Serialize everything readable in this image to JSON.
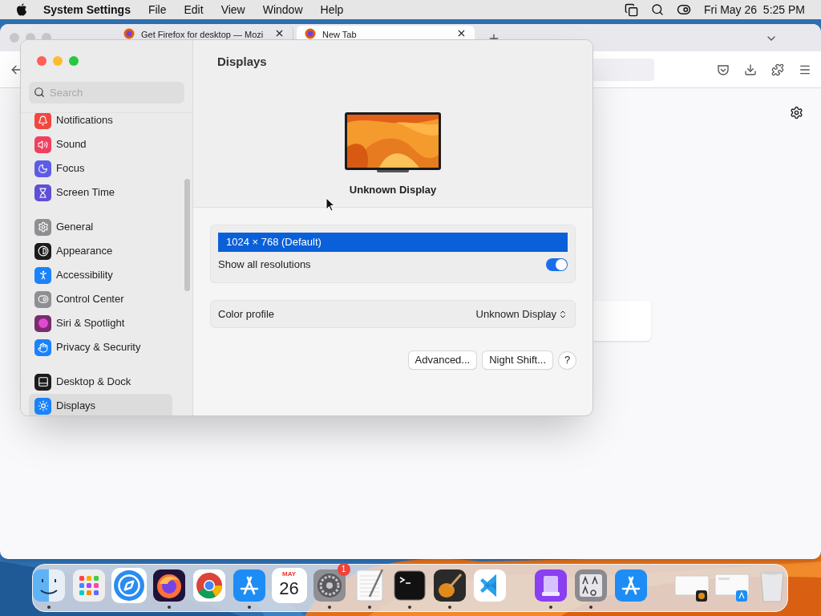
{
  "menu_bar": {
    "app": "System Settings",
    "menus": [
      "File",
      "Edit",
      "View",
      "Window",
      "Help"
    ],
    "clock": "Fri May 26  5:25 PM"
  },
  "browser": {
    "tabs": [
      {
        "title": "Get Firefox for desktop — Mozi",
        "selected": false
      },
      {
        "title": "New Tab",
        "selected": true
      }
    ]
  },
  "settings": {
    "title": "Displays",
    "search": {
      "placeholder": "Search"
    },
    "sidebar": [
      [
        {
          "label": "Notifications",
          "color": "#f0483e",
          "selected": false
        },
        {
          "label": "Sound",
          "color": "#f0405f",
          "selected": false
        },
        {
          "label": "Focus",
          "color": "#5e5ce6",
          "selected": false
        },
        {
          "label": "Screen Time",
          "color": "#5e4fd6",
          "selected": false
        }
      ],
      [
        {
          "label": "General",
          "color": "#8e8e93",
          "selected": false
        },
        {
          "label": "Appearance",
          "color": "#1c1c1e",
          "selected": false
        },
        {
          "label": "Accessibility",
          "color": "#1a82fb",
          "selected": false
        },
        {
          "label": "Control Center",
          "color": "#8e8e93",
          "selected": false
        },
        {
          "label": "Siri & Spotlight",
          "color": "#7a2d6e",
          "selected": false
        },
        {
          "label": "Privacy & Security",
          "color": "#1a82fb",
          "selected": false
        }
      ],
      [
        {
          "label": "Desktop & Dock",
          "color": "#1c1c1e",
          "selected": false
        },
        {
          "label": "Displays",
          "color": "#1a82fb",
          "selected": true
        }
      ]
    ],
    "display_name": "Unknown Display",
    "resolutions": [
      {
        "label": "1024 × 768 (Default)",
        "selected": true
      }
    ],
    "show_all": {
      "label": "Show all resolutions",
      "on": true
    },
    "color_profile": {
      "label": "Color profile",
      "value": "Unknown Display"
    },
    "buttons": [
      "Advanced...",
      "Night Shift..."
    ],
    "help": "?"
  },
  "dock": {
    "groups": [
      [
        {
          "kind": "finder",
          "running": true
        },
        {
          "kind": "launchpad",
          "running": false
        },
        {
          "kind": "safari",
          "running": false
        },
        {
          "kind": "firefox",
          "running": true
        },
        {
          "kind": "chrome",
          "running": false
        },
        {
          "kind": "appstore",
          "running": true
        },
        {
          "kind": "calendar",
          "running": false,
          "month": "MAY",
          "day": "26"
        },
        {
          "kind": "settings",
          "running": true,
          "badge": "1"
        },
        {
          "kind": "textedit",
          "running": true
        },
        {
          "kind": "terminal",
          "running": true
        },
        {
          "kind": "guitar",
          "running": true
        },
        {
          "kind": "vscode",
          "running": false
        }
      ],
      [
        {
          "kind": "purple",
          "running": true
        },
        {
          "kind": "fontbook",
          "running": true
        },
        {
          "kind": "appstore",
          "running": false
        }
      ],
      [
        {
          "kind": "window",
          "running": false
        },
        {
          "kind": "window2",
          "running": false
        },
        {
          "kind": "trash",
          "running": false
        }
      ]
    ]
  }
}
